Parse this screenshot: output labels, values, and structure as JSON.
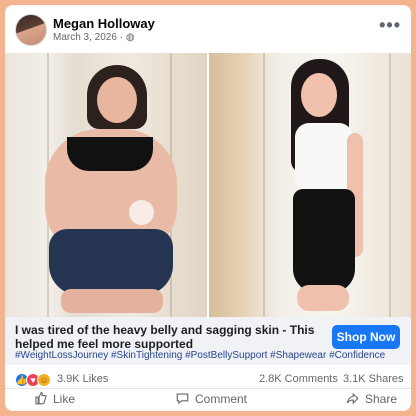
{
  "post": {
    "author": "Megan Holloway",
    "date": "March 3, 2026 · ",
    "privacy_icon": "globe-icon",
    "more_icon": "more-options-icon",
    "image_description_icons": [
      "before-photo",
      "after-photo"
    ],
    "headline": "I was tired of the heavy belly and sagging skin - This helped me feel more supported",
    "cta_label": "Shop Now",
    "hashtags": "#WeightLossJourney #SkinTightening #PostBellySupport #Shapewear #Confidence",
    "reaction_count": "3.9K Likes",
    "comments_count": "2.8K Comments",
    "shares_count": "3.1K Shares",
    "actions": {
      "like": "Like",
      "comment": "Comment",
      "share": "Share"
    },
    "colors": {
      "primary": "#1877f2",
      "border": "#f3b48f",
      "text": "#1c1e21",
      "secondary_text": "#65676b"
    }
  }
}
